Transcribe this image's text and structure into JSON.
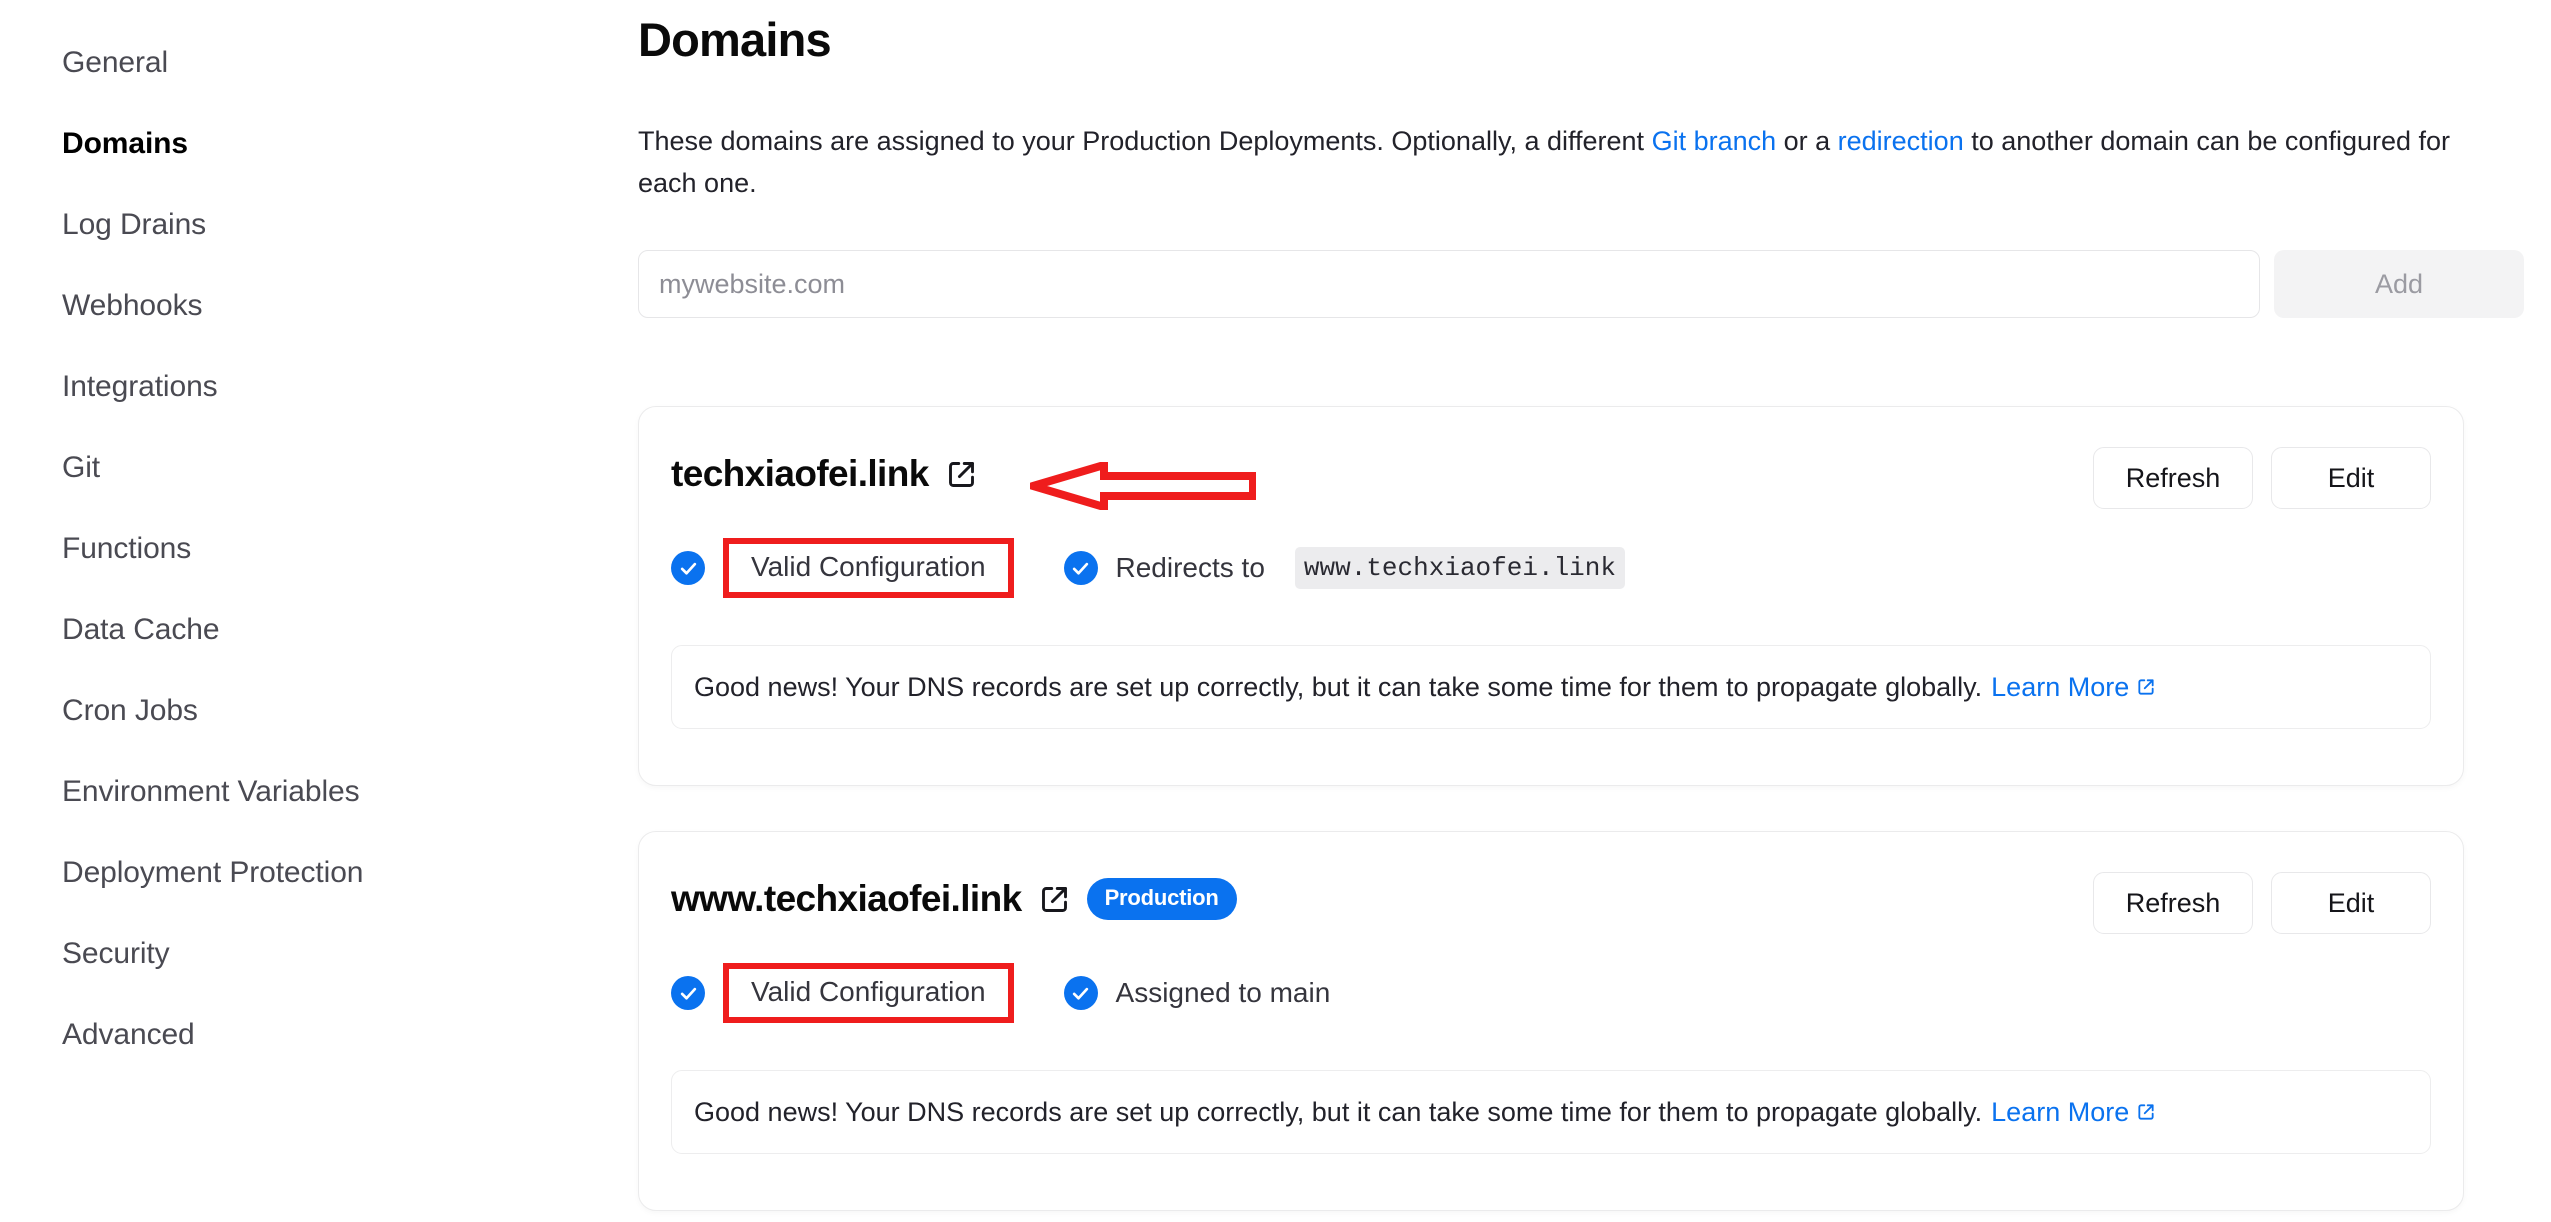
{
  "sidebar": {
    "items": [
      {
        "label": "General",
        "active": false
      },
      {
        "label": "Domains",
        "active": true
      },
      {
        "label": "Log Drains",
        "active": false
      },
      {
        "label": "Webhooks",
        "active": false
      },
      {
        "label": "Integrations",
        "active": false
      },
      {
        "label": "Git",
        "active": false
      },
      {
        "label": "Functions",
        "active": false
      },
      {
        "label": "Data Cache",
        "active": false
      },
      {
        "label": "Cron Jobs",
        "active": false
      },
      {
        "label": "Environment Variables",
        "active": false
      },
      {
        "label": "Deployment Protection",
        "active": false
      },
      {
        "label": "Security",
        "active": false
      },
      {
        "label": "Advanced",
        "active": false
      }
    ]
  },
  "main": {
    "title": "Domains",
    "description": {
      "part1": "These domains are assigned to your Production Deployments. Optionally, a different ",
      "link1": "Git branch",
      "part2": " or a ",
      "link2": "redirection",
      "part3": " to another domain can be configured for each one."
    },
    "add_domain": {
      "placeholder": "mywebsite.com",
      "value": "",
      "button_label": "Add"
    },
    "cards": [
      {
        "domain": "techxiaofei.link",
        "external_link_icon": "external-link-icon",
        "badge": "",
        "refresh_label": "Refresh",
        "edit_label": "Edit",
        "status_primary": "Valid Configuration",
        "status_secondary_label": "Redirects to",
        "status_secondary_value": "www.techxiaofei.link",
        "notice_text": "Good news! Your DNS records are set up correctly, but it can take some time for them to propagate globally.",
        "notice_link": "Learn More"
      },
      {
        "domain": "www.techxiaofei.link",
        "external_link_icon": "external-link-icon",
        "badge": "Production",
        "refresh_label": "Refresh",
        "edit_label": "Edit",
        "status_primary": "Valid Configuration",
        "status_secondary_label": "Assigned to main",
        "status_secondary_value": "",
        "notice_text": "Good news! Your DNS records are set up correctly, but it can take some time for them to propagate globally.",
        "notice_link": "Learn More"
      }
    ]
  },
  "annotations": {
    "arrow_color": "#ef1d1d",
    "highlight_box_color": "#ef1d1d",
    "arrow_direction": "left",
    "arrow_target": "techxiaofei.link"
  },
  "colors": {
    "accent_blue": "#0a72ef",
    "text_primary": "#0a0a0a",
    "text_secondary": "#4a4a52",
    "annotation_red": "#ef1d1d",
    "card_border": "#ebebec",
    "chip_bg": "#ececee"
  }
}
